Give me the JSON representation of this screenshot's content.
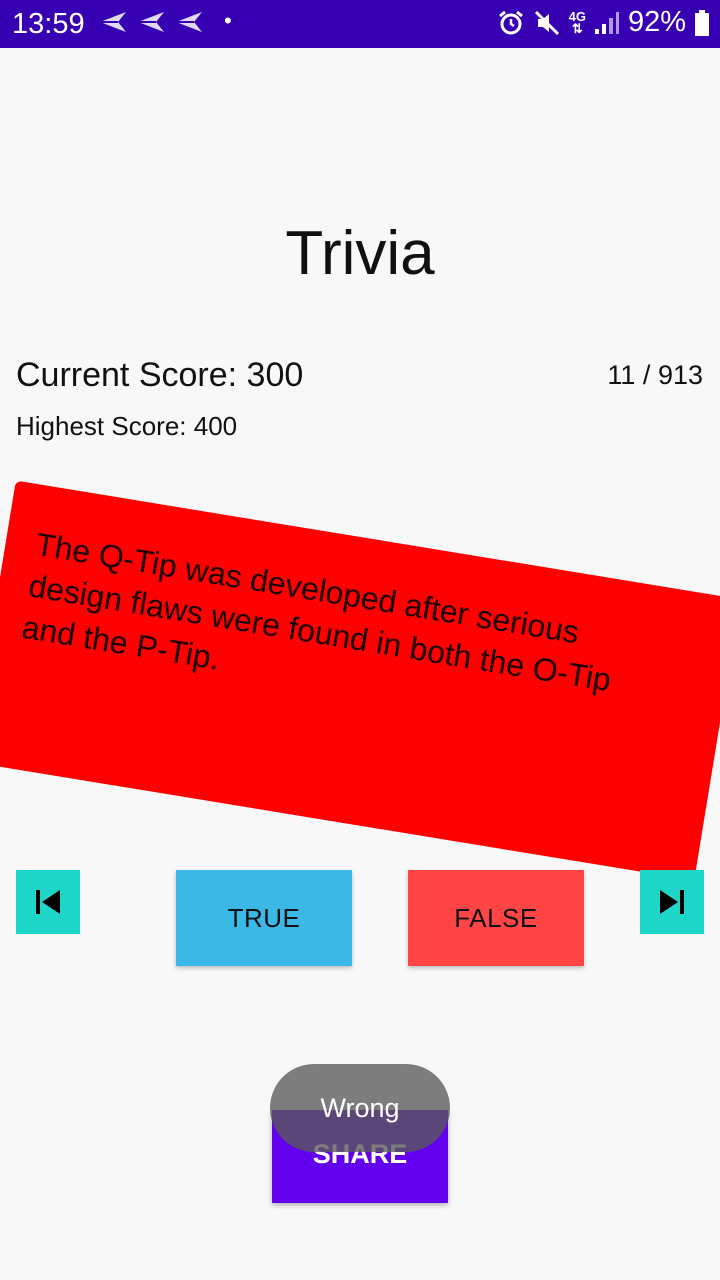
{
  "status_bar": {
    "time": "13:59",
    "network": "4G",
    "battery": "92%",
    "background": "#3700b3"
  },
  "app": {
    "title": "Trivia"
  },
  "score": {
    "current": "Current Score: 300",
    "highest": "Highest Score: 400",
    "progress": "11 / 913"
  },
  "question": {
    "text": "The Q-Tip was developed after serious design flaws were found in both the O-Tip and the P-Tip.",
    "card_color": "#ff0000"
  },
  "buttons": {
    "prev_icon": "skip-previous-icon",
    "next_icon": "skip-next-icon",
    "true_label": "TRUE",
    "false_label": "FALSE",
    "share_label": "SHARE"
  },
  "toast": {
    "message": "Wrong"
  },
  "colors": {
    "nav": "#1ed6c8",
    "true": "#3bb8e6",
    "false": "#ff4545",
    "share": "#6200ee"
  }
}
